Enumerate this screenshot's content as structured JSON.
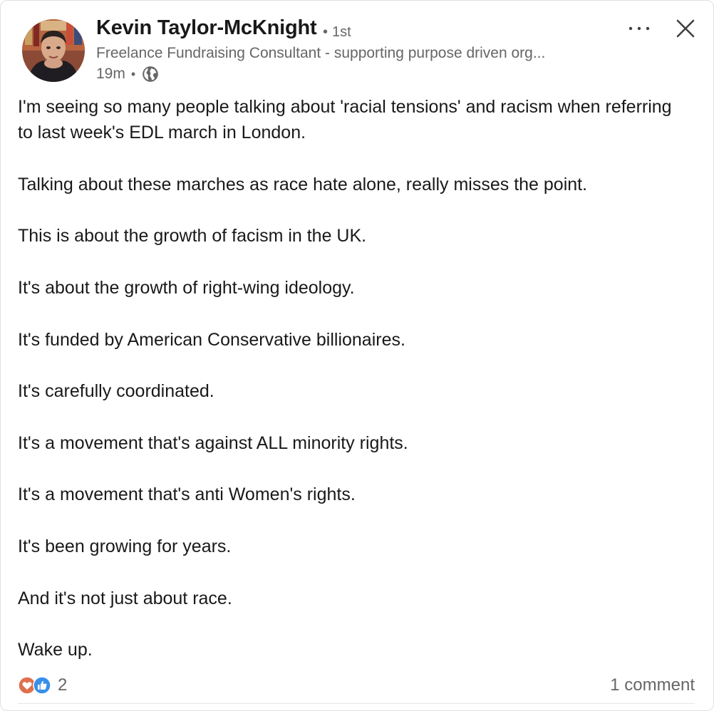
{
  "author": {
    "name": "Kevin Taylor-McKnight",
    "degree": "1st",
    "headline": "Freelance Fundraising Consultant - supporting purpose driven org...",
    "time": "19m",
    "visibility_icon": "globe-icon"
  },
  "actions": {
    "more_icon": "more-icon",
    "close_icon": "close-icon"
  },
  "post": {
    "paragraphs": [
      "I'm seeing so many people talking about 'racial tensions' and racism when referring to last week's EDL march in London.",
      "Talking about these marches as race hate alone, really misses the point.",
      "This is about the growth of facism in the UK.",
      "It's about the growth of right-wing ideology.",
      "It's funded by American Conservative billionaires.",
      "It's carefully coordinated.",
      "It's a movement that's against ALL minority rights.",
      "It's a movement that's anti Women's rights.",
      "It's been growing for years.",
      "And it's not just about race.",
      "Wake up."
    ]
  },
  "social": {
    "reaction_icons": [
      "love-icon",
      "like-icon"
    ],
    "reaction_count": "2",
    "comments": "1 comment"
  },
  "colors": {
    "text_primary": "#191919",
    "text_secondary": "#666666",
    "love": "#df704d",
    "like": "#378fe9"
  }
}
